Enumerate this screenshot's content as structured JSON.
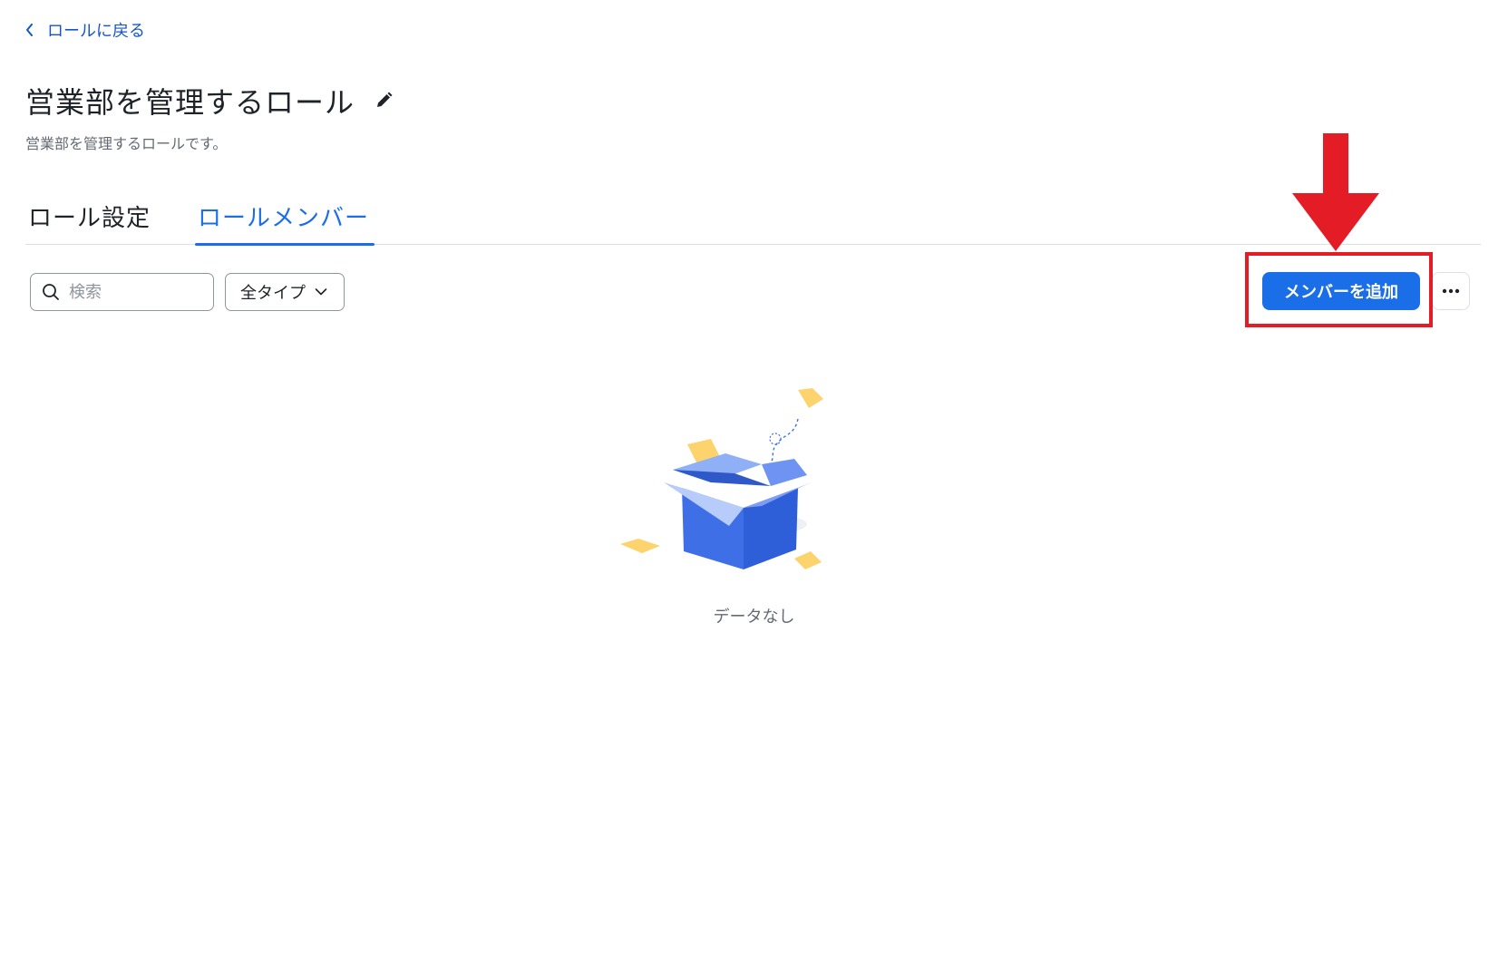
{
  "back_link": {
    "label": "ロールに戻る"
  },
  "header": {
    "title": "営業部を管理するロール",
    "description": "営業部を管理するロールです。"
  },
  "tabs": [
    {
      "label": "ロール設定",
      "active": false
    },
    {
      "label": "ロールメンバー",
      "active": true
    }
  ],
  "toolbar": {
    "search_placeholder": "検索",
    "search_value": "",
    "type_filter_value": "全タイプ",
    "add_member_label": "メンバーを追加",
    "more_icon": "more-horizontal-icon"
  },
  "empty_state": {
    "text": "データなし",
    "icon": "empty-box-icon"
  },
  "colors": {
    "accent": "#1a6fe8",
    "link": "#1456c6",
    "annotation_red": "#e41c26",
    "box_blue": "#3f6fe6",
    "paper_yellow": "#fcd36c"
  }
}
